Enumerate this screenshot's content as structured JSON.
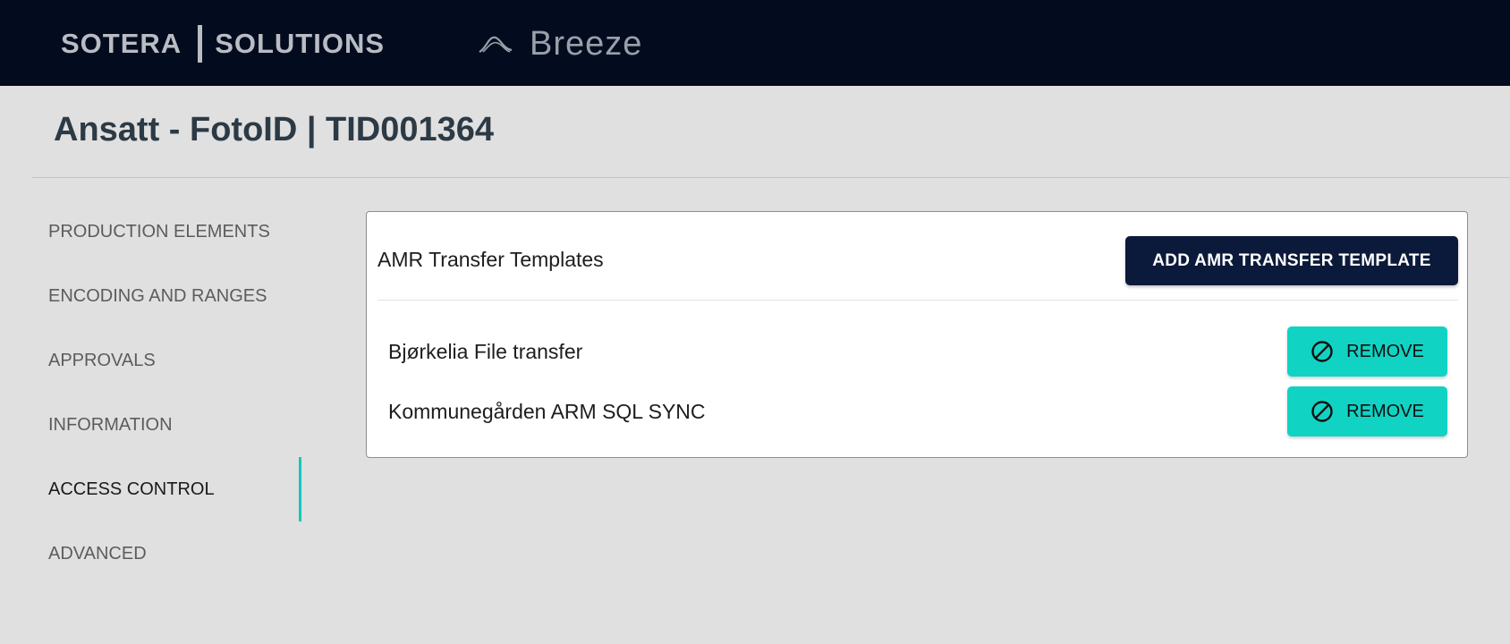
{
  "header": {
    "brand_left": "SOTERA",
    "brand_right": "SOLUTIONS",
    "product_name": "Breeze",
    "background": "#030c1e"
  },
  "page": {
    "title": "Ansatt - FotoID | TID001364"
  },
  "sidebar": {
    "items": [
      {
        "label": "PRODUCTION ELEMENTS",
        "active": false
      },
      {
        "label": "ENCODING AND RANGES",
        "active": false
      },
      {
        "label": "APPROVALS",
        "active": false
      },
      {
        "label": "INFORMATION",
        "active": false
      },
      {
        "label": "ACCESS CONTROL",
        "active": true
      },
      {
        "label": "ADVANCED",
        "active": false
      }
    ],
    "active_indicator_color": "#11c9bb"
  },
  "card": {
    "title": "AMR Transfer Templates",
    "add_button_label": "ADD AMR TRANSFER TEMPLATE",
    "rows": [
      {
        "label": "Bjørkelia File transfer",
        "action_label": "REMOVE",
        "action_icon": "block-icon"
      },
      {
        "label": "Kommunegården ARM SQL SYNC",
        "action_label": "REMOVE",
        "action_icon": "block-icon"
      }
    ]
  },
  "colors": {
    "accent": "#11d3c4",
    "primary_button": "#0b1a3a",
    "background": "#e0e0e0"
  }
}
